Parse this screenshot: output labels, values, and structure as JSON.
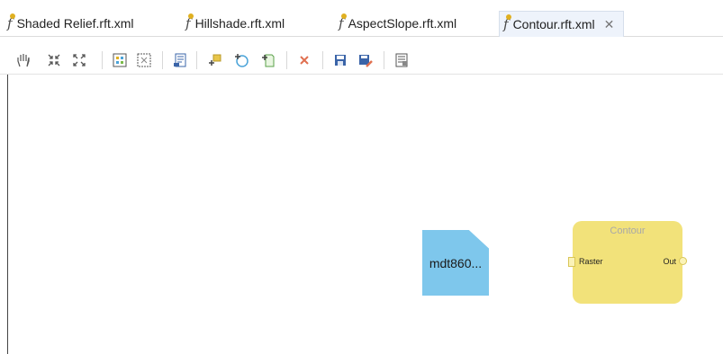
{
  "tabs": [
    {
      "label": "Shaded Relief.rft.xml",
      "active": false
    },
    {
      "label": "Hillshade.rft.xml",
      "active": false
    },
    {
      "label": "AspectSlope.rft.xml",
      "active": false
    },
    {
      "label": "Contour.rft.xml",
      "active": true
    }
  ],
  "toolbar": {
    "icons": [
      "pan-icon",
      "collapse-icon",
      "expand-icon",
      "fit-view-icon",
      "zoom-extent-icon",
      "script-icon",
      "add-function-icon",
      "add-raster-icon",
      "add-document-icon",
      "delete-icon",
      "save-icon",
      "save-as-icon",
      "properties-icon"
    ]
  },
  "canvas": {
    "raster_node": {
      "label": "mdt860..."
    },
    "function_node": {
      "title": "Contour",
      "input_label": "Raster",
      "output_label": "Out"
    }
  },
  "colors": {
    "raster_node": "#7ec7ec",
    "function_node": "#f2e27a",
    "delete_icon": "#e07050",
    "save_icon": "#3a64a8"
  }
}
